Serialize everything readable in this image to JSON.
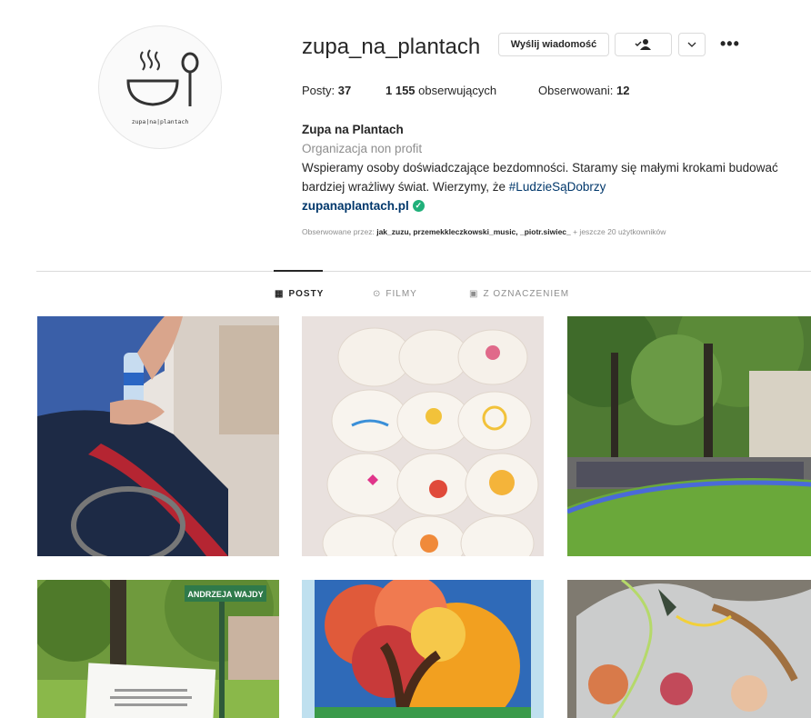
{
  "profile": {
    "username": "zupa_na_plantach",
    "avatar_text": "zupa|na|plantach",
    "buttons": {
      "message": "Wyślij wiadomość",
      "follow_icon": "person-check-icon",
      "more_icon": "chevron-down-icon",
      "options_icon": "more-horizontal-icon"
    },
    "stats": {
      "posts_label": "Posty: ",
      "posts_value": "37",
      "followers_value": "1 155",
      "followers_label": " obserwujących",
      "following_label": "Obserwowani: ",
      "following_value": "12"
    },
    "bio": {
      "name": "Zupa na Plantach",
      "category": "Organizacja non profit",
      "text_line1": "Wspieramy osoby doświadczające bezdomności. Staramy się małymi krokami budować",
      "text_line2_prefix": "bardziej wrażliwy świat. Wierzymy, że ",
      "hashtag": "#LudzieSąDobrzy",
      "link": "zupanaplantach.pl"
    },
    "followed_by": {
      "prefix": "Obserwowane przez: ",
      "users": "jak_zuzu, przemekkleczkowski_music, _piotr.siwiec_",
      "suffix": " + jeszcze 20 użytkowników"
    }
  },
  "tabs": [
    {
      "label": "POSTY",
      "icon": "grid-icon"
    },
    {
      "label": "FILMY",
      "icon": "play-icon"
    },
    {
      "label": "Z OZNACZENIEM",
      "icon": "tag-icon"
    }
  ],
  "posts": [
    {
      "icon": "photo-wheelchair"
    },
    {
      "icon": "photo-painted-bags"
    },
    {
      "icon": "photo-park-gathering"
    },
    {
      "icon": "photo-street-sign",
      "sign_text": "ANDRZEJA WAJDY"
    },
    {
      "icon": "photo-tree-painting"
    },
    {
      "icon": "photo-gift-baskets"
    }
  ]
}
